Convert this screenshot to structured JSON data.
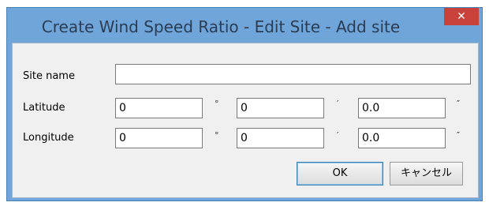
{
  "window": {
    "title": "Create Wind Speed Ratio - Edit Site - Add site",
    "close_label": "✕"
  },
  "site_name": {
    "label": "Site name",
    "value": ""
  },
  "latitude": {
    "label": "Latitude",
    "degrees": "0",
    "minutes": "0",
    "seconds": "0.0"
  },
  "longitude": {
    "label": "Longitude",
    "degrees": "0",
    "minutes": "0",
    "seconds": "0.0"
  },
  "units": {
    "degree": "°",
    "minute": "′",
    "second": "″"
  },
  "buttons": {
    "ok": "OK",
    "cancel": "キャンセル"
  },
  "colors": {
    "title_bar": "#6fa5d8",
    "close_button": "#c9413b",
    "client_background": "#f0f0f0"
  }
}
